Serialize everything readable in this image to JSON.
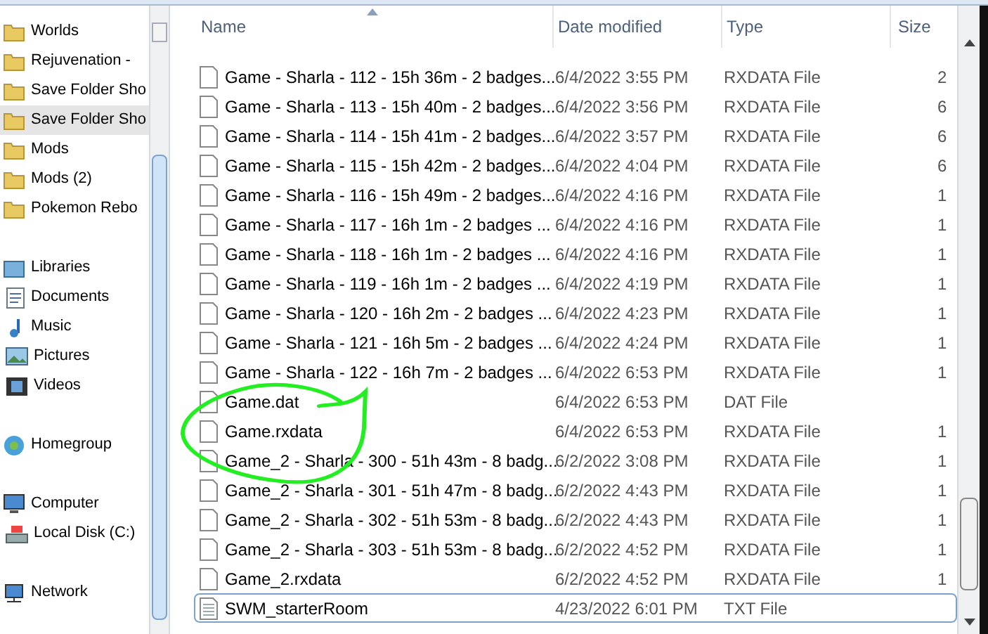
{
  "nav": {
    "groups": [
      {
        "items": [
          {
            "label": "Worlds",
            "kind": "folder",
            "selected": false
          },
          {
            "label": "Rejuvenation -",
            "kind": "folder",
            "selected": false
          },
          {
            "label": "Save Folder Sho",
            "kind": "folder",
            "selected": false
          },
          {
            "label": "Save Folder Sho",
            "kind": "folder",
            "selected": true
          },
          {
            "label": "Mods",
            "kind": "folder",
            "selected": false
          },
          {
            "label": "Mods (2)",
            "kind": "folder",
            "selected": false
          },
          {
            "label": "Pokemon Rebo",
            "kind": "folder",
            "selected": false
          }
        ]
      },
      {
        "items": [
          {
            "label": "Libraries",
            "kind": "libraries",
            "selected": false
          },
          {
            "label": "Documents",
            "kind": "documents",
            "selected": false
          },
          {
            "label": "Music",
            "kind": "music",
            "selected": false
          },
          {
            "label": "Pictures",
            "kind": "pictures",
            "selected": false
          },
          {
            "label": "Videos",
            "kind": "videos",
            "selected": false
          }
        ]
      },
      {
        "items": [
          {
            "label": "Homegroup",
            "kind": "homegroup",
            "selected": false
          }
        ]
      },
      {
        "items": [
          {
            "label": "Computer",
            "kind": "computer",
            "selected": false
          },
          {
            "label": "Local Disk (C:)",
            "kind": "disk",
            "selected": false
          }
        ]
      },
      {
        "items": [
          {
            "label": "Network",
            "kind": "network",
            "selected": false
          }
        ]
      }
    ]
  },
  "table": {
    "columns": [
      "Name",
      "Date modified",
      "Type",
      "Size"
    ],
    "rows": [
      {
        "name": "Game - Sharla - 112 - 15h 36m - 2 badges...",
        "date": "6/4/2022 3:55 PM",
        "type": "RXDATA File",
        "size": "2",
        "kind": "file",
        "selected": false
      },
      {
        "name": "Game - Sharla - 113 - 15h 40m - 2 badges...",
        "date": "6/4/2022 3:56 PM",
        "type": "RXDATA File",
        "size": "6",
        "kind": "file",
        "selected": false
      },
      {
        "name": "Game - Sharla - 114 - 15h 41m - 2 badges...",
        "date": "6/4/2022 3:57 PM",
        "type": "RXDATA File",
        "size": "6",
        "kind": "file",
        "selected": false
      },
      {
        "name": "Game - Sharla - 115 - 15h 42m - 2 badges...",
        "date": "6/4/2022 4:04 PM",
        "type": "RXDATA File",
        "size": "6",
        "kind": "file",
        "selected": false
      },
      {
        "name": "Game - Sharla - 116 - 15h 49m - 2 badges...",
        "date": "6/4/2022 4:16 PM",
        "type": "RXDATA File",
        "size": "1",
        "kind": "file",
        "selected": false
      },
      {
        "name": "Game - Sharla - 117 - 16h 1m - 2 badges ...",
        "date": "6/4/2022 4:16 PM",
        "type": "RXDATA File",
        "size": "1",
        "kind": "file",
        "selected": false
      },
      {
        "name": "Game - Sharla - 118 - 16h 1m - 2 badges ...",
        "date": "6/4/2022 4:16 PM",
        "type": "RXDATA File",
        "size": "1",
        "kind": "file",
        "selected": false
      },
      {
        "name": "Game - Sharla - 119 - 16h 1m - 2 badges ...",
        "date": "6/4/2022 4:19 PM",
        "type": "RXDATA File",
        "size": "1",
        "kind": "file",
        "selected": false
      },
      {
        "name": "Game - Sharla - 120 - 16h 2m - 2 badges ...",
        "date": "6/4/2022 4:23 PM",
        "type": "RXDATA File",
        "size": "1",
        "kind": "file",
        "selected": false
      },
      {
        "name": "Game - Sharla - 121 - 16h 5m - 2 badges ...",
        "date": "6/4/2022 4:24 PM",
        "type": "RXDATA File",
        "size": "1",
        "kind": "file",
        "selected": false
      },
      {
        "name": "Game - Sharla - 122 - 16h 7m - 2 badges ...",
        "date": "6/4/2022 6:53 PM",
        "type": "RXDATA File",
        "size": "1",
        "kind": "file",
        "selected": false
      },
      {
        "name": "Game.dat",
        "date": "6/4/2022 6:53 PM",
        "type": "DAT File",
        "kind": "file",
        "selected": false
      },
      {
        "name": "Game.rxdata",
        "date": "6/4/2022 6:53 PM",
        "type": "RXDATA File",
        "size": "1",
        "kind": "file",
        "selected": false
      },
      {
        "name": "Game_2 - Sharla - 300 - 51h 43m - 8 badg...",
        "date": "6/2/2022 3:08 PM",
        "type": "RXDATA File",
        "size": "1",
        "kind": "file",
        "selected": false
      },
      {
        "name": "Game_2 - Sharla - 301 - 51h 47m - 8 badg...",
        "date": "6/2/2022 4:43 PM",
        "type": "RXDATA File",
        "size": "1",
        "kind": "file",
        "selected": false
      },
      {
        "name": "Game_2 - Sharla - 302 - 51h 53m - 8 badg...",
        "date": "6/2/2022 4:43 PM",
        "type": "RXDATA File",
        "size": "1",
        "kind": "file",
        "selected": false
      },
      {
        "name": "Game_2 - Sharla - 303 - 51h 53m - 8 badg...",
        "date": "6/2/2022 4:52 PM",
        "type": "RXDATA File",
        "size": "1",
        "kind": "file",
        "selected": false
      },
      {
        "name": "Game_2.rxdata",
        "date": "6/2/2022 4:52 PM",
        "type": "RXDATA File",
        "size": "1",
        "kind": "file",
        "selected": false
      },
      {
        "name": "SWM_starterRoom",
        "date": "4/23/2022 6:01 PM",
        "type": "TXT File",
        "kind": "text",
        "selected": true
      }
    ]
  }
}
